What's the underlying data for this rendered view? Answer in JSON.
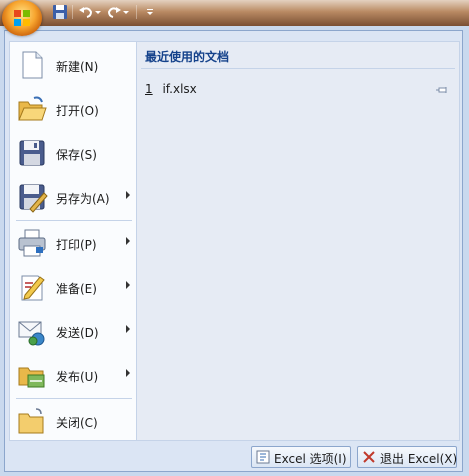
{
  "menu": {
    "items": [
      {
        "label": "新建(N)",
        "icon": "new-document-icon",
        "has_submenu": false
      },
      {
        "label": "打开(O)",
        "icon": "open-folder-icon",
        "has_submenu": false
      },
      {
        "label": "保存(S)",
        "icon": "save-icon",
        "has_submenu": false
      },
      {
        "label": "另存为(A)",
        "icon": "save-as-icon",
        "has_submenu": true
      },
      {
        "label": "打印(P)",
        "icon": "print-icon",
        "has_submenu": true
      },
      {
        "label": "准备(E)",
        "icon": "prepare-icon",
        "has_submenu": true
      },
      {
        "label": "发送(D)",
        "icon": "send-icon",
        "has_submenu": true
      },
      {
        "label": "发布(U)",
        "icon": "publish-icon",
        "has_submenu": true
      },
      {
        "label": "关闭(C)",
        "icon": "close-folder-icon",
        "has_submenu": false
      }
    ]
  },
  "recent": {
    "title": "最近使用的文档",
    "files": [
      {
        "number": "1",
        "name": "if.xlsx",
        "icon": "pin-icon"
      }
    ]
  },
  "buttons": {
    "options_label": "Excel 选项(I)",
    "exit_label": "退出 Excel(X)"
  },
  "colors": {
    "office_button": "#f7a52f",
    "title_text": "#15428b",
    "panel_bg": "#dbe5f4"
  }
}
